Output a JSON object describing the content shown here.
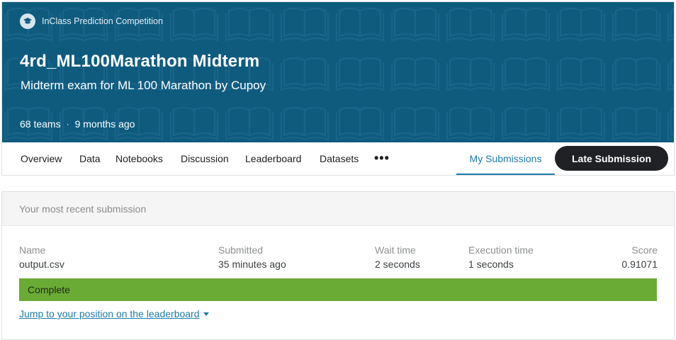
{
  "competition": {
    "type_label": "InClass Prediction Competition",
    "title": "4rd_ML100Marathon Midterm",
    "subtitle": "Midterm exam for ML 100 Marathon by Cupoy",
    "teams": "68 teams",
    "separator": "·",
    "age": "9 months ago"
  },
  "tabs": [
    {
      "label": "Overview"
    },
    {
      "label": "Data"
    },
    {
      "label": "Notebooks"
    },
    {
      "label": "Discussion"
    },
    {
      "label": "Leaderboard"
    },
    {
      "label": "Datasets"
    },
    {
      "label": "•••"
    },
    {
      "label": "My Submissions"
    }
  ],
  "late_submission_label": "Late Submission",
  "submission": {
    "header": "Your most recent submission",
    "columns": {
      "name": {
        "label": "Name",
        "value": "output.csv"
      },
      "submitted": {
        "label": "Submitted",
        "value": "35 minutes ago"
      },
      "wait": {
        "label": "Wait time",
        "value": "2 seconds"
      },
      "execution": {
        "label": "Execution time",
        "value": "1 seconds"
      },
      "score": {
        "label": "Score",
        "value": "0.91071"
      }
    },
    "status": "Complete",
    "jump_link": "Jump to your position on the leaderboard"
  },
  "colors": {
    "banner": "#0e5b7e",
    "accent": "#1e7ba8",
    "status_complete": "#6aab35",
    "button_dark": "#202124"
  },
  "icons": {
    "competition_type": "graduation-cap-icon",
    "banner_pattern": "open-book-icon",
    "dropdown": "caret-down-icon"
  }
}
